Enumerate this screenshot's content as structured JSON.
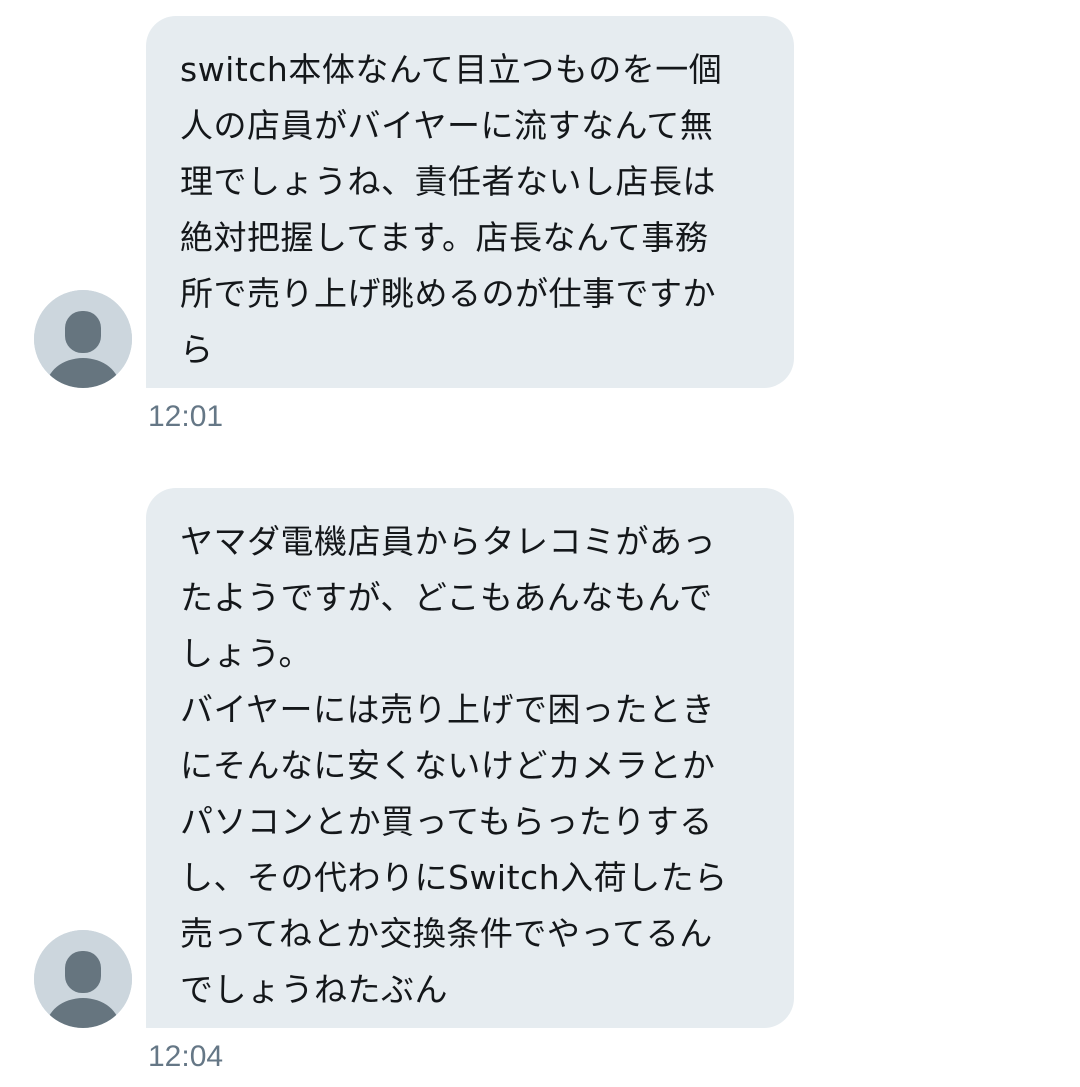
{
  "messages": [
    {
      "text": "switch本体なんて目立つものを一個\n人の店員がバイヤーに流すなんて無\n理でしょうね、責任者ないし店長は\n絶対把握してます。店長なんて事務\n所で売り上げ眺めるのが仕事ですか\nら",
      "time": "12:01",
      "avatar_icon": "default-profile-icon"
    },
    {
      "text": "ヤマダ電機店員からタレコミがあっ\nたようですが、どこもあんなもんで\nしょう。\nバイヤーには売り上げで困ったとき\nにそんなに安くないけどカメラとか\nパソコンとか買ってもらったりする\nし、その代わりにSwitch入荷したら\n売ってねとか交換条件でやってるん\nでしょうねたぶん",
      "time": "12:04",
      "avatar_icon": "default-profile-icon"
    }
  ],
  "colors": {
    "bubble_bg": "#e6ecf0",
    "text": "#14171a",
    "timestamp": "#657786",
    "avatar_bg": "#ccd6dd",
    "avatar_figure": "#66757f"
  }
}
